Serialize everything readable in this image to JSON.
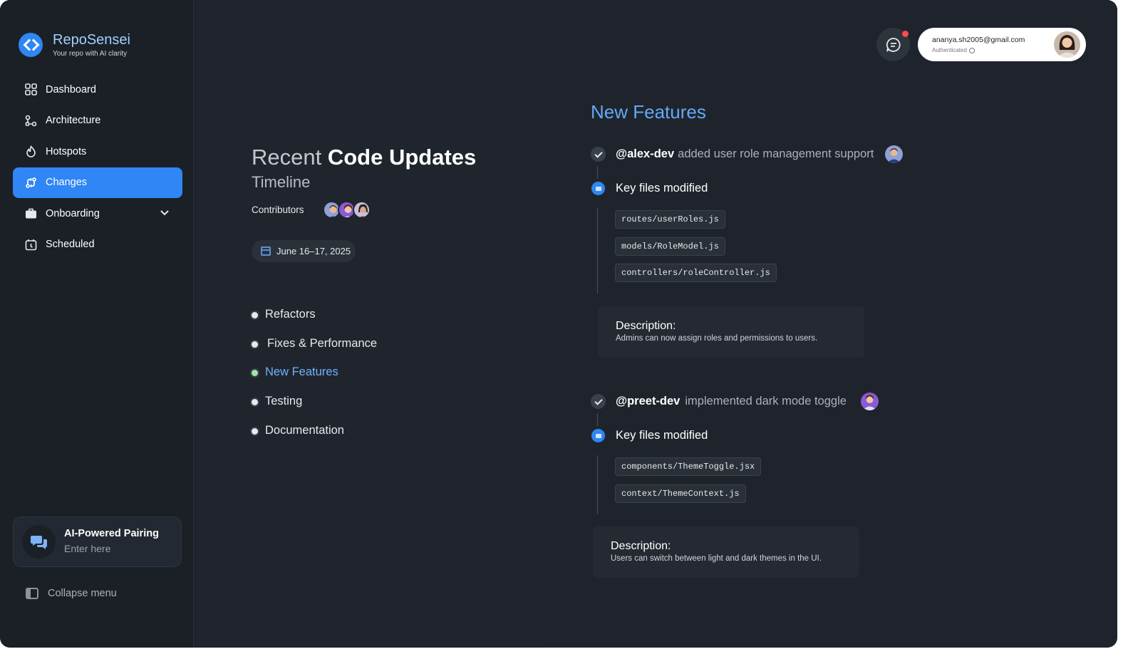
{
  "brand": {
    "name": "RepoSensei",
    "tagline": "Your repo with AI clarity"
  },
  "sidebar": {
    "items": [
      {
        "label": "Dashboard",
        "icon": "grid-icon"
      },
      {
        "label": "Architecture",
        "icon": "nodes-icon"
      },
      {
        "label": "Hotspots",
        "icon": "flame-icon"
      },
      {
        "label": "Changes",
        "icon": "git-compare-icon",
        "active": true
      },
      {
        "label": "Onboarding",
        "icon": "briefcase-icon",
        "expandable": true
      },
      {
        "label": "Scheduled",
        "icon": "calendar-clock-icon"
      }
    ],
    "pairing": {
      "title": "AI-Powered Pairing",
      "placeholder": "Enter here",
      "icon": "chat-bubbles-icon"
    },
    "collapse_label": "Collapse menu"
  },
  "middle": {
    "title_light": "Recent",
    "title_bold": "Code Updates",
    "subtitle": "Timeline",
    "contributors_label": "Contributors",
    "date_range": "June 16–17, 2025",
    "categories": [
      {
        "label": "Refactors"
      },
      {
        "label": "Fixes & Performance"
      },
      {
        "label": "New Features",
        "active": true
      },
      {
        "label": "Testing"
      },
      {
        "label": "Documentation"
      }
    ]
  },
  "header": {
    "user_email": "ananya.sh2005@gmail.com",
    "auth_status": "Authenticated",
    "notification": true
  },
  "right": {
    "section_title": "New Features",
    "entries": [
      {
        "handle": "@alex-dev",
        "action": "added user role management support",
        "files_label": "Key files modified",
        "files": [
          "routes/userRoles.js",
          "models/RoleModel.js",
          "controllers/roleController.js"
        ],
        "desc_title": "Description:",
        "desc_text": "Admins can now assign roles and permissions to users."
      },
      {
        "handle": "@preet-dev",
        "action": "implemented dark mode toggle",
        "files_label": "Key files modified",
        "files": [
          "components/ThemeToggle.jsx",
          "context/ThemeContext.js"
        ],
        "desc_title": "Description:",
        "desc_text": "Users can switch between light and dark themes in the UI."
      }
    ]
  },
  "colors": {
    "accent": "#2f86f4",
    "active_dot": "#9ee6a7",
    "section_title": "#64a8f5",
    "notification": "#ff4b4b"
  }
}
